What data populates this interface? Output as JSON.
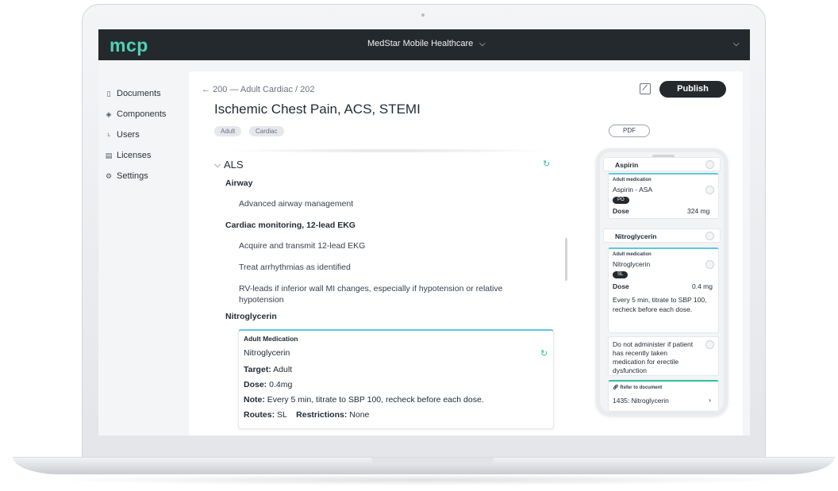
{
  "app": {
    "logo": "mcp",
    "org_name": "MedStar Mobile Healthcare"
  },
  "sidebar": {
    "items": [
      {
        "label": "Documents",
        "icon": "document-icon"
      },
      {
        "label": "Components",
        "icon": "components-icon"
      },
      {
        "label": "Users",
        "icon": "user-icon"
      },
      {
        "label": "Licenses",
        "icon": "license-icon"
      },
      {
        "label": "Settings",
        "icon": "gear-icon"
      }
    ]
  },
  "document": {
    "breadcrumb": "200 — Adult Cardiac / 202",
    "title": "Ischemic Chest Pain, ACS, STEMI",
    "tags": [
      "Adult",
      "Cardiac"
    ],
    "publish_label": "Publish",
    "pdf_label": "PDF"
  },
  "section": {
    "title": "ALS",
    "groups": [
      {
        "heading": "Airway",
        "items": [
          "Advanced airway management"
        ]
      },
      {
        "heading": "Cardiac monitoring, 12-lead EKG",
        "items": [
          "Acquire and transmit 12-lead EKG",
          "Treat arrhythmias as identified",
          "RV-leads if inferior wall MI changes, especially if hypotension or relative hypotension"
        ]
      },
      {
        "heading": "Nitroglycerin",
        "items": []
      }
    ]
  },
  "medication": {
    "label": "Adult Medication",
    "name": "Nitroglycerin",
    "target_label": "Target:",
    "target": "Adult",
    "dose_label": "Dose:",
    "dose": "0.4mg",
    "note_label": "Note:",
    "note": "Every 5 min, titrate to SBP 100, recheck before each dose.",
    "routes_label": "Routes:",
    "routes": "SL",
    "restrictions_label": "Restrictions:",
    "restrictions": "None"
  },
  "preview": {
    "aspirin_header": "Aspirin",
    "aspirin_card": {
      "label": "Adult medication",
      "name": "Aspirin - ASA",
      "route": "PO",
      "dose_label": "Dose",
      "dose": "324 mg"
    },
    "nitro_header": "Nitroglycerin",
    "nitro_card": {
      "label": "Adult medication",
      "name": "Nitroglycerin",
      "route": "SL",
      "dose_label": "Dose",
      "dose": "0.4 mg",
      "note": "Every 5 min, titrate to SBP 100, recheck before each dose."
    },
    "warning": "Do not administer if patient has recently taken medication for erectile dysfunction",
    "refer_label": "Refer to document",
    "refer_doc": "1435: Nitroglycerin"
  },
  "colors": {
    "topbar": "#24292d",
    "brand": "#4fd1b5",
    "accent": "#5ec8df"
  }
}
